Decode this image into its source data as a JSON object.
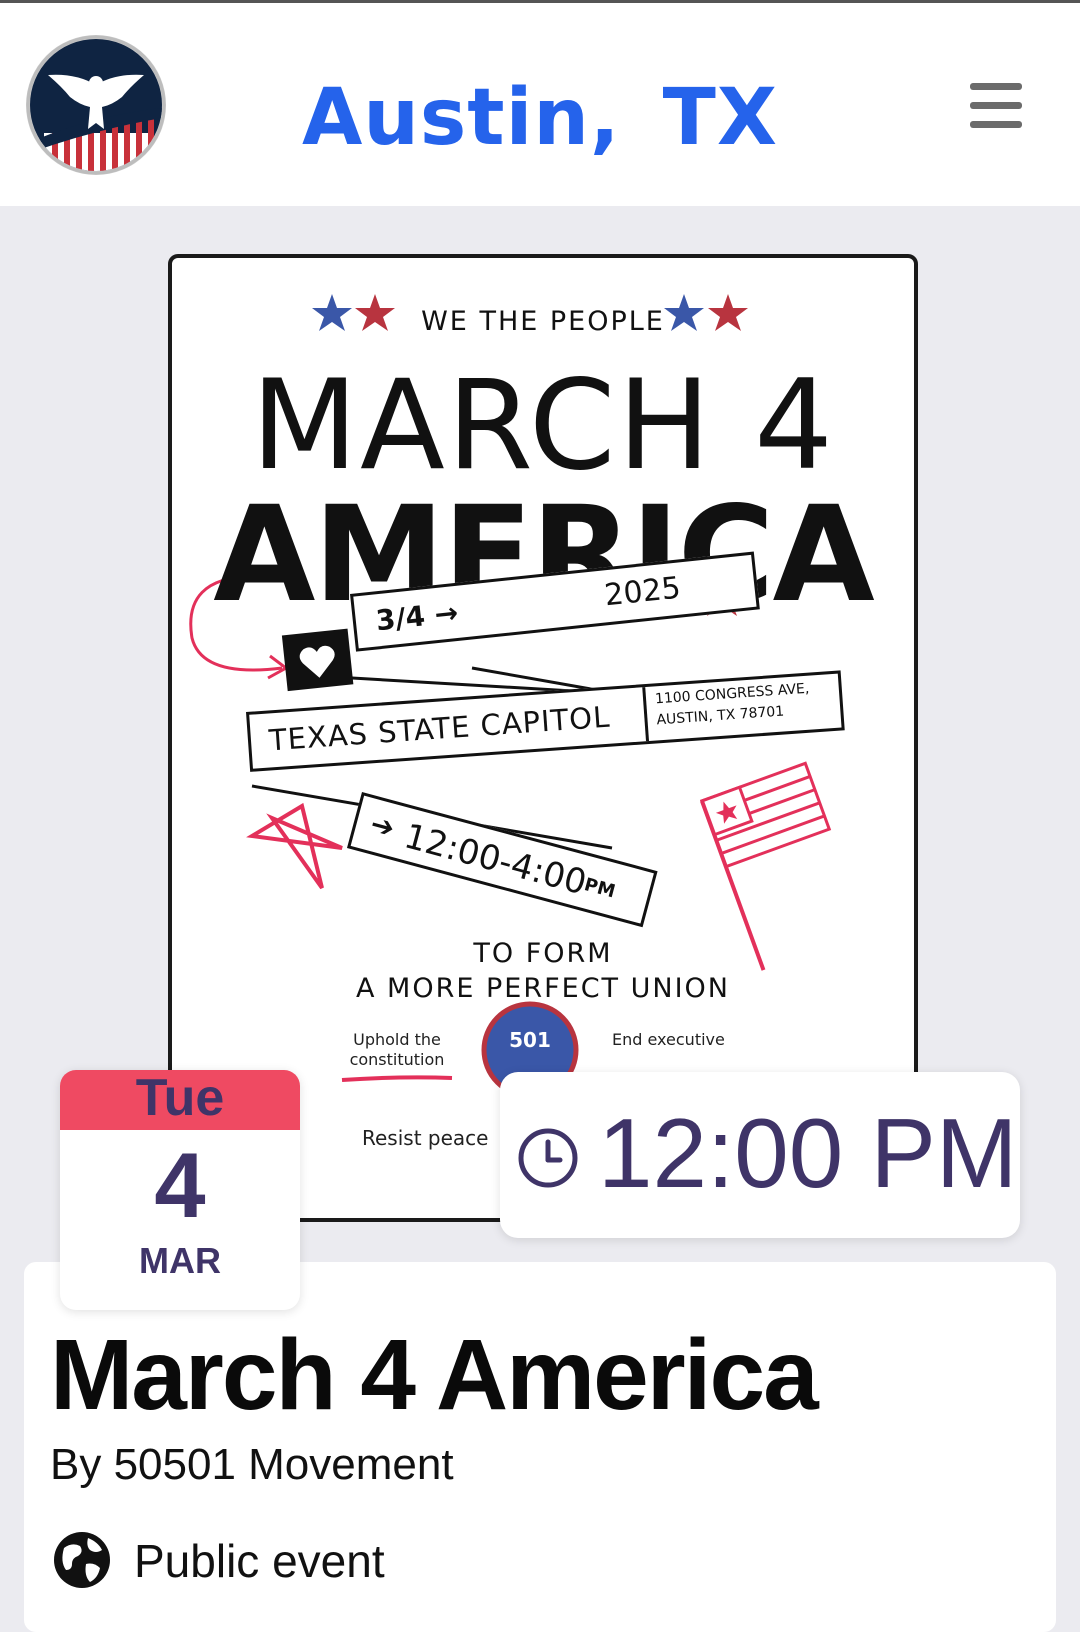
{
  "header": {
    "city": "Austin,  TX",
    "logo": "eagle-flag-logo",
    "menu_icon": "hamburger-menu-icon"
  },
  "poster": {
    "kicker": "WE THE PEOPLE",
    "title_line1": "MARCH 4",
    "title_line2": "AMERICA",
    "date_short": "3/4 →",
    "year": "2025",
    "venue": "TEXAS STATE CAPITOL",
    "address_line1": "1100 CONGRESS AVE,",
    "address_line2": "AUSTIN, TX 78701",
    "time": "12:00-4:00",
    "time_suffix": "PM",
    "tagline_line1": "TO FORM",
    "tagline_line2": "A MORE PERFECT UNION",
    "uphold_line1": "Uphold the",
    "uphold_line2": "constitution",
    "badge": "501",
    "end_exec": "End executive",
    "resist": "Resist peace",
    "colors": {
      "red": "#b8343f",
      "blue": "#3a57a8",
      "pink": "#e3305a"
    }
  },
  "date_badge": {
    "weekday": "Tue",
    "day": "4",
    "month": "MAR"
  },
  "time_badge": {
    "time": "12:00 PM",
    "icon": "clock-icon"
  },
  "event": {
    "title": "March 4 America",
    "organizer": "By 50501 Movement",
    "privacy": "Public event",
    "privacy_icon": "globe-icon"
  },
  "colors": {
    "accent_blue": "#2563eb",
    "calendar_red": "#ef4a62",
    "calendar_text": "#3f3468",
    "page_bg": "#ebebf0"
  }
}
